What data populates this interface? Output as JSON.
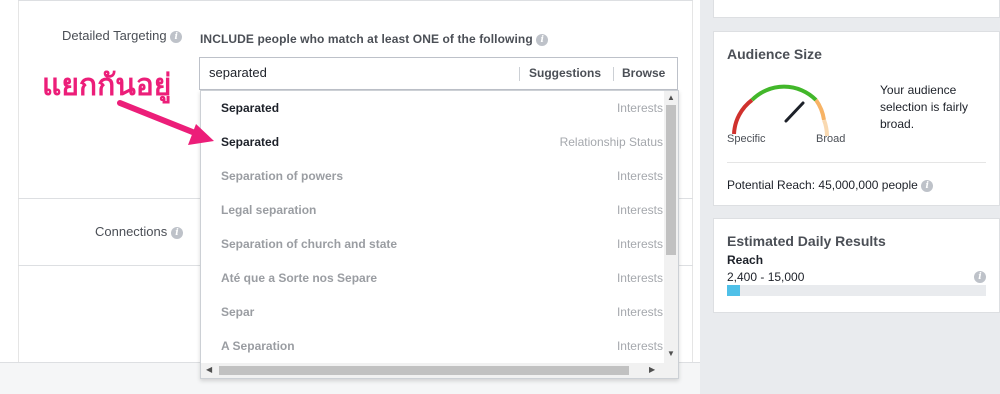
{
  "targeting": {
    "detailed_label": "Detailed Targeting",
    "include_text": "INCLUDE people who match at least ONE of the following",
    "search_value": "separated",
    "suggestions_label": "Suggestions",
    "browse_label": "Browse",
    "connections_label": "Connections"
  },
  "dropdown": {
    "items": [
      {
        "name": "Separated",
        "type": "Interests",
        "active": true
      },
      {
        "name": "Separated",
        "type": "Relationship Status",
        "active": true
      },
      {
        "name": "Separation of powers",
        "type": "Interests",
        "active": false
      },
      {
        "name": "Legal separation",
        "type": "Interests",
        "active": false
      },
      {
        "name": "Separation of church and state",
        "type": "Interests",
        "active": false
      },
      {
        "name": "Até que a Sorte nos Separe",
        "type": "Interests",
        "active": false
      },
      {
        "name": "Separ",
        "type": "Interests",
        "active": false
      },
      {
        "name": "A Separation",
        "type": "Interests",
        "active": false
      }
    ]
  },
  "annotation": {
    "text": "แยกกันอยู่",
    "color": "#ec1e79"
  },
  "audience": {
    "title": "Audience Size",
    "gauge_specific": "Specific",
    "gauge_broad": "Broad",
    "gauge_level": 0.72,
    "description": "Your audience selection is fairly broad.",
    "potential_reach": "Potential Reach: 45,000,000 people"
  },
  "daily": {
    "title": "Estimated Daily Results",
    "reach_label": "Reach",
    "reach_value": "2,400 - 15,000",
    "reach_fill_pct": 5
  },
  "colors": {
    "gauge_red": "#d0312d",
    "gauge_green": "#42b72a",
    "gauge_orange": "#f7b365",
    "bar_fill": "#4fc0e8"
  },
  "icons": [
    "info-icon",
    "arrow-up-icon",
    "arrow-down-icon",
    "arrow-left-icon",
    "arrow-right-icon",
    "gauge-needle-icon"
  ]
}
